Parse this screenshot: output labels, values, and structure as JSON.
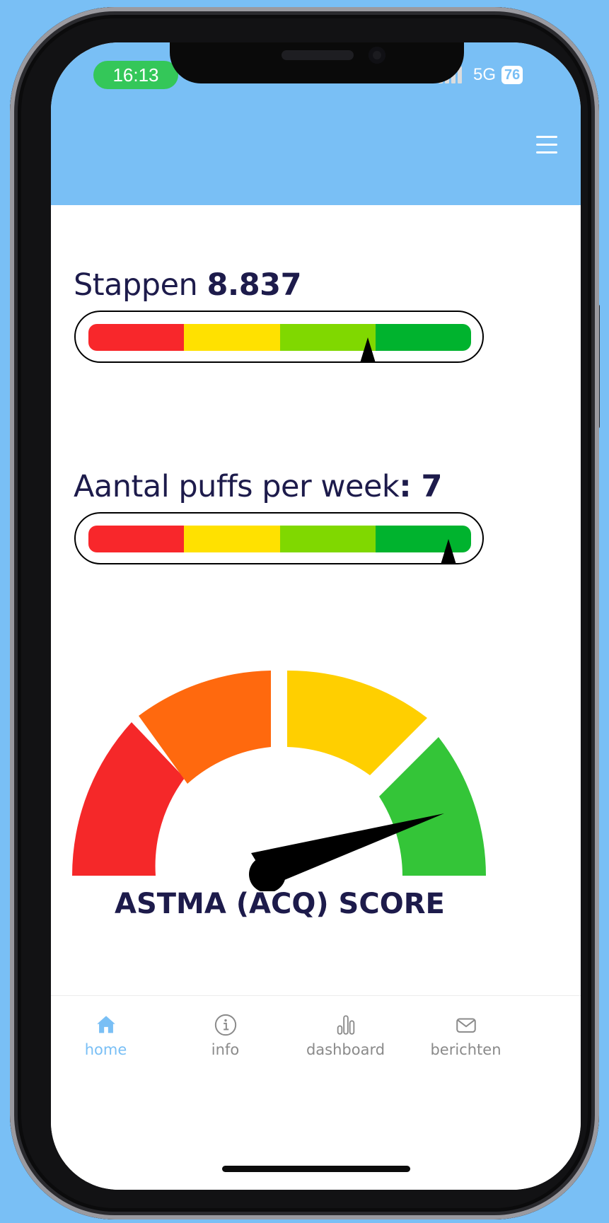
{
  "status_bar": {
    "time": "16:13",
    "network": "5G",
    "battery": "76"
  },
  "metrics": {
    "steps": {
      "label": "Stappen ",
      "value": "8.837",
      "segments": [
        "#f8272b",
        "#ffe100",
        "#80d800",
        "#00b32e"
      ],
      "pointer_position": 0.73
    },
    "puffs": {
      "label": "Aantal puffs per week",
      "value": ": 7",
      "segments": [
        "#f8272b",
        "#ffe100",
        "#80d800",
        "#00b32e"
      ],
      "pointer_position": 0.94
    }
  },
  "gauge": {
    "title": "ASTMA (ACQ) SCORE",
    "segment_colors": [
      "#f52829",
      "#ff690e",
      "#ffcf00",
      "#34c538"
    ],
    "needle_color": "#000000"
  },
  "tabbar": {
    "items": [
      {
        "label": "home",
        "icon": "home-icon",
        "active": true
      },
      {
        "label": "info",
        "icon": "info-icon",
        "active": false
      },
      {
        "label": "dashboard",
        "icon": "bar-chart-icon",
        "active": false
      },
      {
        "label": "berichten",
        "icon": "mail-icon",
        "active": false
      }
    ]
  },
  "colors": {
    "brand": "#79bff5",
    "text_dark": "#1d1b4b",
    "tab_inactive": "#8a8a8a"
  }
}
